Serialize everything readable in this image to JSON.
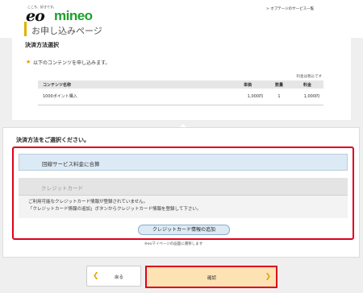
{
  "header": {
    "tagline": "ここち、好きです。",
    "logo_eo": "eo",
    "logo_mineo": "mineo",
    "services_link": "> オプテージのサービス一覧"
  },
  "page_heading": "お申し込みページ",
  "payment_section": {
    "title": "決済方法選択",
    "star": "★",
    "intro": "以下のコンテンツを申し込みます。",
    "tax_note": "料金は税込です",
    "table": {
      "headers": [
        "コンテンツ名称",
        "単価",
        "数量",
        "料金"
      ],
      "rows": [
        [
          "1000ポイント購入",
          "1,000円",
          "1",
          "1,000円"
        ]
      ]
    }
  },
  "payment_method": {
    "prompt": "決済方法をご選択ください。",
    "carrier_option": "回線サービス料金に合算",
    "card_option": "クレジットカード",
    "card_message_1": "ご利用可能なクレジットカード情報が登録されていません。",
    "card_message_2": "「クレジットカード情報の追加」ボタンからクレジットカード情報を登録して下さい。",
    "add_card_button": "クレジットカード情報の追加",
    "eo_note": "※eoマイページの画面に遷移します"
  },
  "buttons": {
    "back": "戻る",
    "confirm": "確認"
  },
  "colors": {
    "brand_green": "#1da02c",
    "highlight_red": "#e0001a",
    "accent_yellow": "#e6a400"
  }
}
